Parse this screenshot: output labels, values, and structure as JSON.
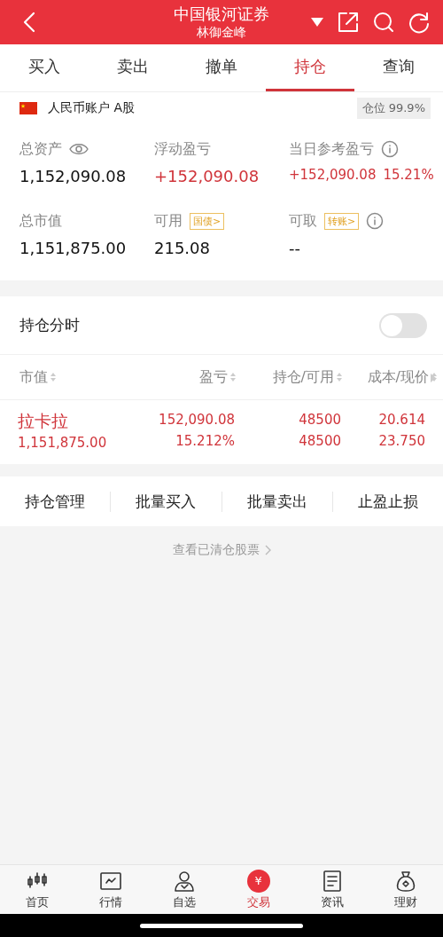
{
  "header": {
    "title": "中国银河证券",
    "subtitle": "林御金峰"
  },
  "tabs": [
    {
      "label": "买入",
      "selected": false
    },
    {
      "label": "卖出",
      "selected": false
    },
    {
      "label": "撤单",
      "selected": false
    },
    {
      "label": "持仓",
      "selected": true
    },
    {
      "label": "查询",
      "selected": false
    }
  ],
  "account": {
    "name": "人民币账户 A股",
    "position": "仓位 99.9%"
  },
  "summary": [
    {
      "label": "总资产",
      "kind": "eye",
      "value": "1,152,090.08",
      "gain": false
    },
    {
      "label": "浮动盈亏",
      "kind": "plain",
      "value": "+152,090.08",
      "gain": true
    },
    {
      "label": "当日参考盈亏",
      "kind": "info",
      "value": "+152,090.08",
      "extra": "15.21%",
      "gain": true
    },
    {
      "label": "总市值",
      "kind": "plain",
      "value": "1,151,875.00",
      "gain": false
    },
    {
      "label": "可用",
      "kind": "tag",
      "tag": "国债>",
      "value": "215.08",
      "gain": false
    },
    {
      "label": "可取",
      "kind": "tag-info",
      "tag": "转账>",
      "value": "--",
      "gain": false
    }
  ],
  "timeshare": {
    "label": "持仓分时",
    "on": false
  },
  "table": {
    "columns": [
      "市值",
      "盈亏",
      "持仓/可用",
      "成本/现价"
    ],
    "rows": [
      {
        "cells": [
          [
            "拉卡拉",
            "1,151,875.00"
          ],
          [
            "152,090.08",
            "15.212%"
          ],
          [
            "48500",
            "48500"
          ],
          [
            "20.614",
            "23.750"
          ]
        ]
      }
    ]
  },
  "actions": [
    "持仓管理",
    "批量买入",
    "批量卖出",
    "止盈止损"
  ],
  "cleared_link": "查看已清仓股票",
  "nav": [
    {
      "label": "首页",
      "kind": "candles",
      "selected": false
    },
    {
      "label": "行情",
      "kind": "chart",
      "selected": false
    },
    {
      "label": "自选",
      "kind": "person",
      "selected": false
    },
    {
      "label": "交易",
      "kind": "yuan",
      "glyph": "¥",
      "selected": true
    },
    {
      "label": "资讯",
      "kind": "doc",
      "selected": false
    },
    {
      "label": "理财",
      "kind": "bag",
      "selected": false
    }
  ]
}
